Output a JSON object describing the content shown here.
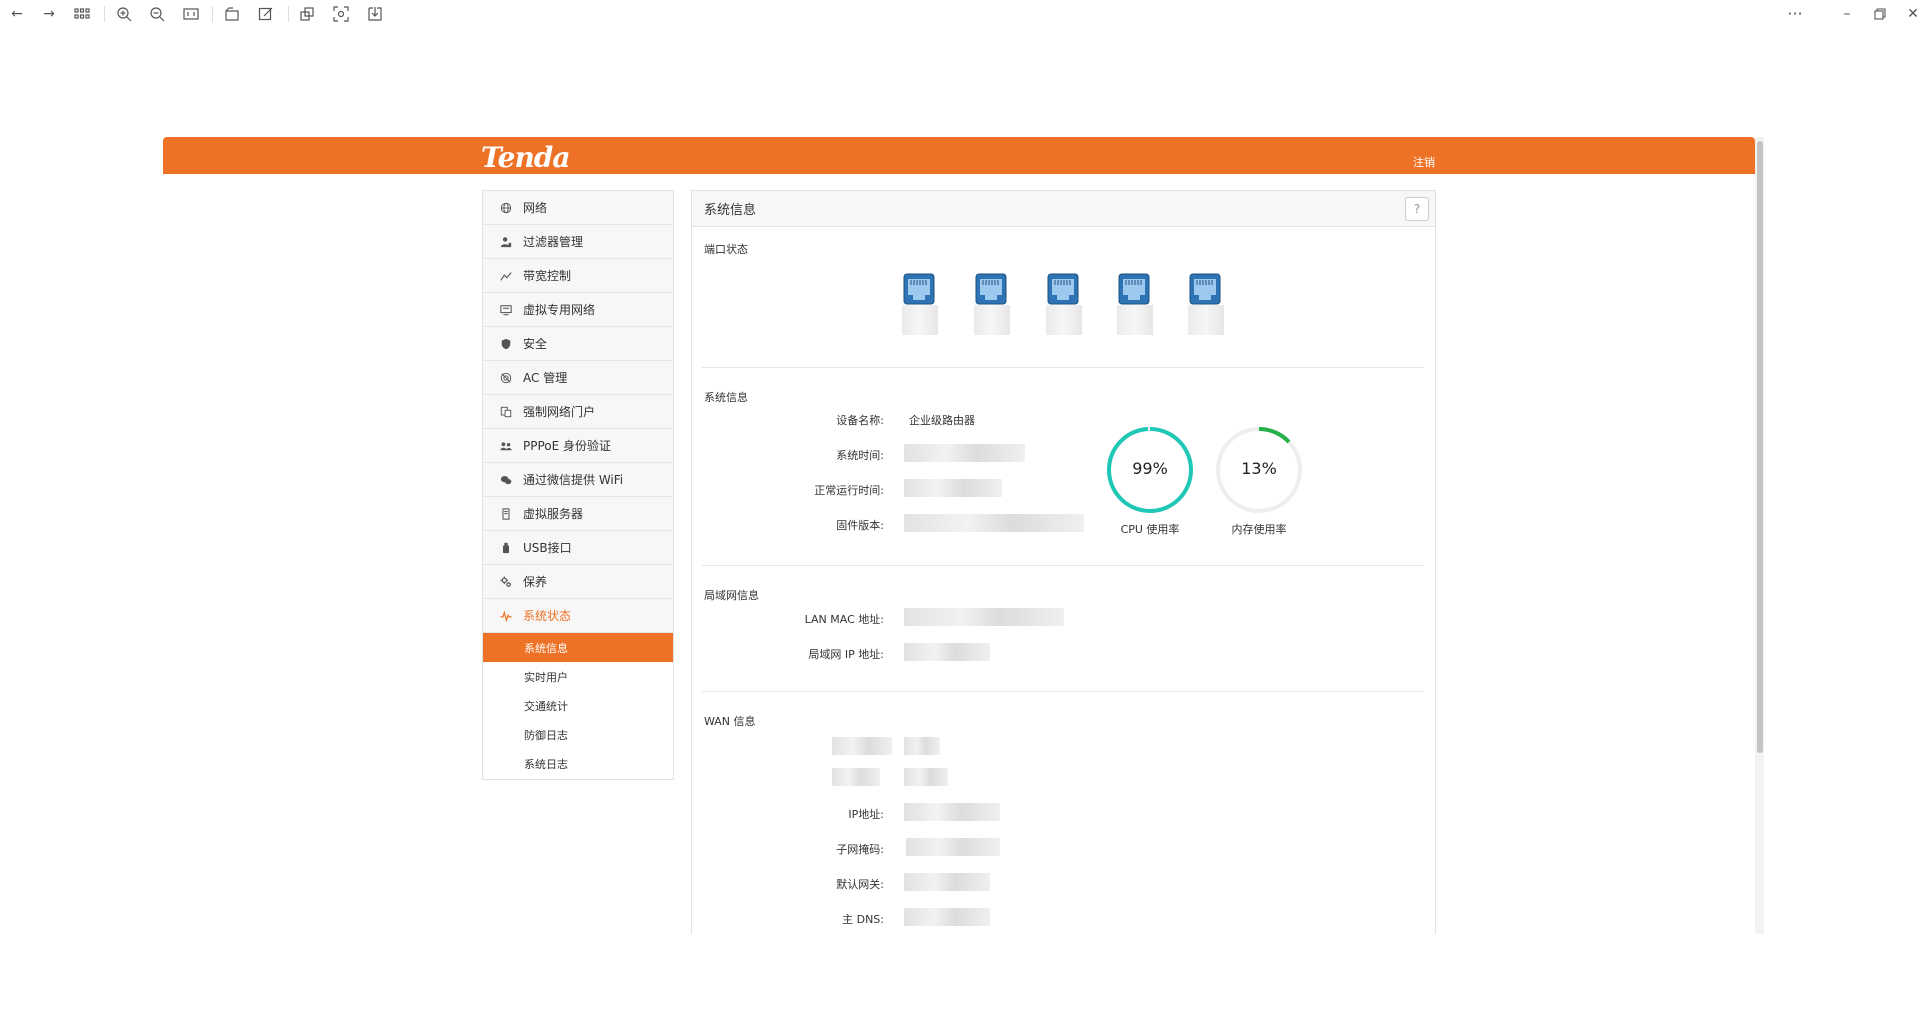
{
  "viewer": {
    "toolbar": [
      "back-arrow-icon",
      "forward-arrow-icon",
      "grid-icon",
      "zoom-in-icon",
      "zoom-out-icon",
      "fit-icon",
      "rotate-icon",
      "edit-icon",
      "crop-icon",
      "scan-icon",
      "save-icon"
    ],
    "window_controls": [
      "more-icon",
      "minimize-icon",
      "restore-icon",
      "close-icon"
    ]
  },
  "header": {
    "logo": "Tenda",
    "logout": "注销",
    "brand_color": "#ee7225"
  },
  "sidebar": {
    "items": [
      {
        "label": "网络",
        "icon": "globe-icon"
      },
      {
        "label": "过滤器管理",
        "icon": "user-filter-icon"
      },
      {
        "label": "带宽控制",
        "icon": "chart-line-icon"
      },
      {
        "label": "虚拟专用网络",
        "icon": "monitor-icon"
      },
      {
        "label": "安全",
        "icon": "shield-icon"
      },
      {
        "label": "AC 管理",
        "icon": "ac-icon"
      },
      {
        "label": "强制网络门户",
        "icon": "portal-icon"
      },
      {
        "label": "PPPoE 身份验证",
        "icon": "pppoe-icon"
      },
      {
        "label": "通过微信提供 WiFi",
        "icon": "wechat-icon"
      },
      {
        "label": "虚拟服务器",
        "icon": "server-icon"
      },
      {
        "label": "USB接口",
        "icon": "usb-icon"
      },
      {
        "label": "保养",
        "icon": "gear-icon"
      },
      {
        "label": "系统状态",
        "icon": "pulse-icon"
      }
    ],
    "submenu": [
      "系统信息",
      "实时用户",
      "交通统计",
      "防御日志",
      "系统日志"
    ]
  },
  "main": {
    "title": "系统信息",
    "help": "?",
    "port_section": "端口状态",
    "sys_section": "系统信息",
    "device_name_label": "设备名称:",
    "device_name_value": "企业级路由器",
    "system_time_label": "系统时间:",
    "uptime_label": "正常运行时间:",
    "firmware_label": "固件版本:",
    "cpu_value": "99%",
    "cpu_label": "CPU 使用率",
    "mem_value": "13%",
    "mem_label": "内存使用率",
    "lan_section": "局域网信息",
    "lan_mac_label": "LAN MAC 地址:",
    "lan_ip_label": "局域网 IP 地址:",
    "wan_section": "WAN 信息",
    "ip_label": "IP地址:",
    "mask_label": "子网掩码:",
    "gateway_label": "默认网关:",
    "dns_label": "主 DNS:"
  },
  "gauges": {
    "cpu": {
      "fraction": 0.99,
      "color": "#1fc7b6"
    },
    "mem": {
      "fraction": 0.13,
      "color": "#25b14a"
    }
  }
}
